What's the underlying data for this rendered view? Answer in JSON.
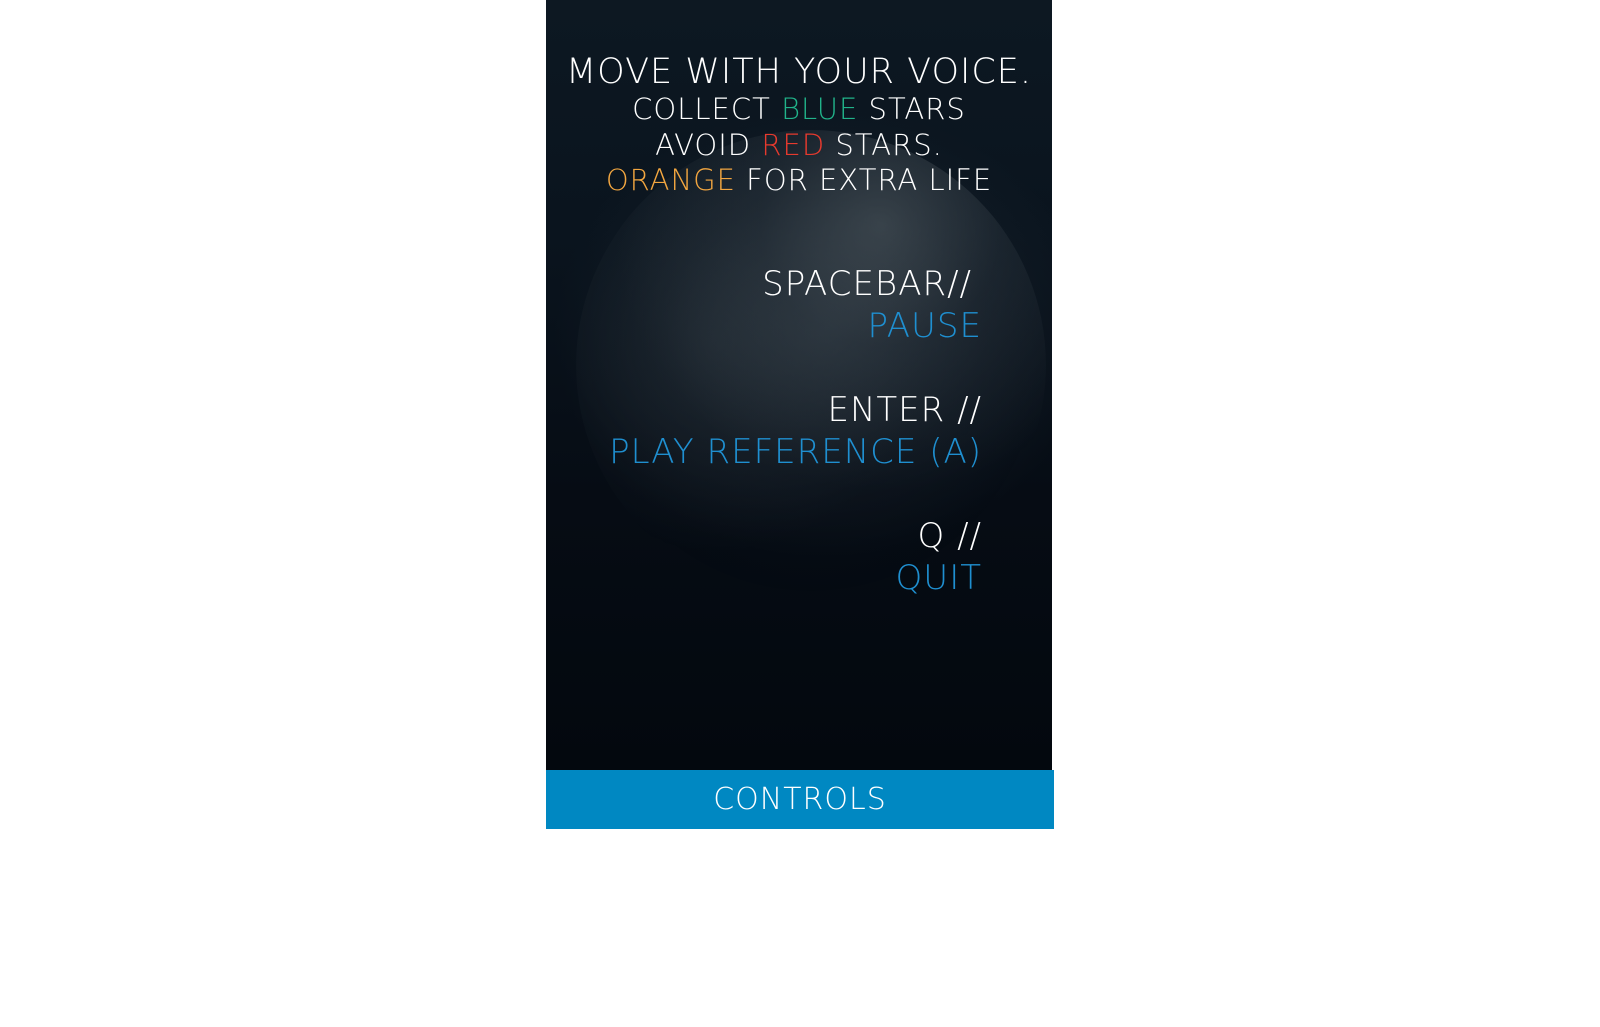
{
  "instructions": {
    "line1": "MOVE WITH YOUR VOICE.",
    "line2_pre": "COLLECT ",
    "line2_color": "BLUE",
    "line2_post": " STARS",
    "line3_pre": "AVOID ",
    "line3_color": "RED",
    "line3_post": " STARS.",
    "line4_color": "ORANGE",
    "line4_post": " FOR EXTRA LIFE"
  },
  "controls": [
    {
      "key": "SPACEBAR//",
      "action": "PAUSE"
    },
    {
      "key": "ENTER //",
      "action": "PLAY REFERENCE (A)"
    },
    {
      "key": "Q //",
      "action": "QUIT"
    }
  ],
  "footer": {
    "label": "CONTROLS"
  },
  "colors": {
    "blue_star": "#21b38a",
    "red_star": "#e63a2e",
    "orange_star": "#f2a640",
    "action_text": "#1f8fd0",
    "footer_bg": "#0088c2",
    "panel_bg": "#0a141e"
  }
}
